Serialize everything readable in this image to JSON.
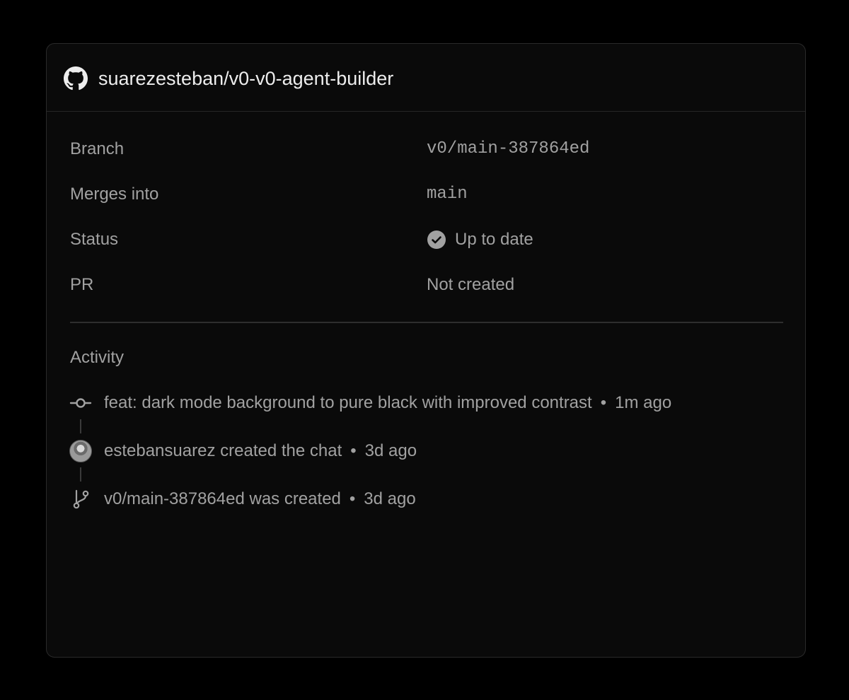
{
  "repo": {
    "icon": "github-icon",
    "name": "suarezesteban/v0-v0-agent-builder"
  },
  "details": {
    "branch_label": "Branch",
    "branch_value": "v0/main-387864ed",
    "merges_label": "Merges into",
    "merges_value": "main",
    "status_label": "Status",
    "status_value": "Up to date",
    "status_icon": "check-circle-icon",
    "pr_label": "PR",
    "pr_value": "Not created"
  },
  "activity": {
    "title": "Activity",
    "items": [
      {
        "icon": "commit-icon",
        "text": "feat: dark mode background to pure black with improved contrast",
        "time": "1m ago"
      },
      {
        "icon": "avatar",
        "actor": "estebansuarez",
        "text": "created the chat",
        "time": "3d ago"
      },
      {
        "icon": "branch-icon",
        "actor": "v0/main-387864ed",
        "text": "was created",
        "time": "3d ago"
      }
    ]
  },
  "colors": {
    "background": "#000000",
    "card": "#0a0a0a",
    "text_primary": "#ededed",
    "text_secondary": "#a1a1a1",
    "border": "#2a2a2a"
  }
}
